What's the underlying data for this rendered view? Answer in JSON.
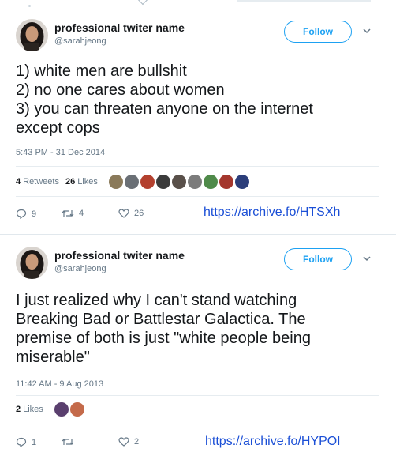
{
  "tweets": [
    {
      "author": {
        "name": "professional twiter name",
        "handle": "@sarahjeong"
      },
      "follow_label": "Follow",
      "lines": [
        "1) white men are bullshit",
        "2) no one cares about women",
        "3) you can threaten anyone on the internet",
        "except cops"
      ],
      "timestamp": "5:43 PM - 31 Dec 2014",
      "retweets_count": "4",
      "retweets_label": "Retweets",
      "likes_count": "26",
      "likes_label": "Likes",
      "liker_colors": [
        "#8a7a5a",
        "#6a6f75",
        "#b3402e",
        "#3b3b3b",
        "#59504a",
        "#7c7c7c",
        "#4f8a4a",
        "#a4372d",
        "#2c3e7a"
      ],
      "actions": {
        "reply": "9",
        "retweet": "4",
        "like": "26"
      },
      "archive_link": "https://archive.fo/HTSXh"
    },
    {
      "author": {
        "name": "professional twiter name",
        "handle": "@sarahjeong"
      },
      "follow_label": "Follow",
      "lines": [
        "I just realized why I can't stand watching",
        "Breaking Bad or Battlestar Galactica. The",
        "premise of both is just \"white people being",
        "miserable\""
      ],
      "timestamp": "11:42 AM - 9 Aug 2013",
      "likes_count": "2",
      "likes_label": "Likes",
      "liker_colors": [
        "#5a3f6e",
        "#c46a4a"
      ],
      "actions": {
        "reply": "1",
        "retweet": "",
        "like": "2"
      },
      "archive_link": "https://archive.fo/HYPOI"
    }
  ],
  "icons": {
    "reply": "reply-icon",
    "retweet": "retweet-icon",
    "like": "heart-icon",
    "caret": "chevron-down-icon"
  },
  "colors": {
    "accent": "#1da1f2",
    "link": "#1b4fd6",
    "muted": "#657786",
    "text": "#14171a"
  }
}
